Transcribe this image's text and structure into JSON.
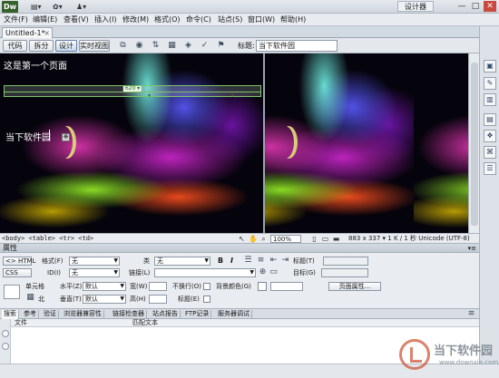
{
  "app": {
    "logo": "Dw",
    "layout_label": "设计器",
    "accent": "#35612a"
  },
  "titlebar_icons": [
    {
      "name": "layout-icon",
      "glyph": "▤▾"
    },
    {
      "name": "gear-icon",
      "glyph": "✿▾"
    },
    {
      "name": "user-icon",
      "glyph": "♟▾"
    }
  ],
  "window_buttons": [
    "—",
    "□",
    "✕"
  ],
  "menu": [
    "文件(F)",
    "编辑(E)",
    "查看(V)",
    "插入(I)",
    "修改(M)",
    "格式(O)",
    "命令(C)",
    "站点(S)",
    "窗口(W)",
    "帮助(H)"
  ],
  "document_tab": {
    "label": "Untitled-1*",
    "close": "×"
  },
  "toolbar": {
    "views": [
      "代码",
      "拆分",
      "设计",
      "实时视图"
    ],
    "active_view": "设计",
    "title_label": "标题:",
    "title_value": "当下软件园"
  },
  "canvas": {
    "line1": "这是第一个页面",
    "table_width": "620 ▾",
    "cell_text": "当下软件园"
  },
  "statusbar": {
    "tag_selector": "<body> <table> <tr> <td>",
    "zoom": "100%",
    "dimensions": "883 x 337 ▾ 1 K / 1 秒 Unicode (UTF-8)"
  },
  "properties": {
    "header": "属性",
    "options_glyph": "▾≡",
    "html_btn": "<> HTML",
    "css_btn": "CSS",
    "format_label": "格式(F)",
    "format_value": "无",
    "id_label": "ID(I)",
    "id_value": "无",
    "class_label": "类",
    "class_value": "无",
    "link_label": "链接(L)",
    "bold": "B",
    "italic": "I",
    "title_label": "标题(T)",
    "target_label": "目标(G)",
    "cell_label": "单元格",
    "horz_label": "水平(Z)",
    "horz_value": "默认",
    "vert_label": "垂直(T)",
    "vert_value": "默认",
    "width_label": "宽(W)",
    "height_label": "高(H)",
    "nowrap_label": "不换行(O)",
    "header_label": "标题(E)",
    "bg_label": "背景颜色(G)",
    "page_props_btn": "页面属性..."
  },
  "panel_tabs": [
    "搜索",
    "参考",
    "验证",
    "浏览器兼容性",
    "链接检查器",
    "站点报告",
    "FTP记录",
    "服务器调试"
  ],
  "results": {
    "col_file": "文件",
    "col_match": "匹配文本"
  },
  "watermark": {
    "text": "当下软件园",
    "sub": "www.downxia.com"
  }
}
